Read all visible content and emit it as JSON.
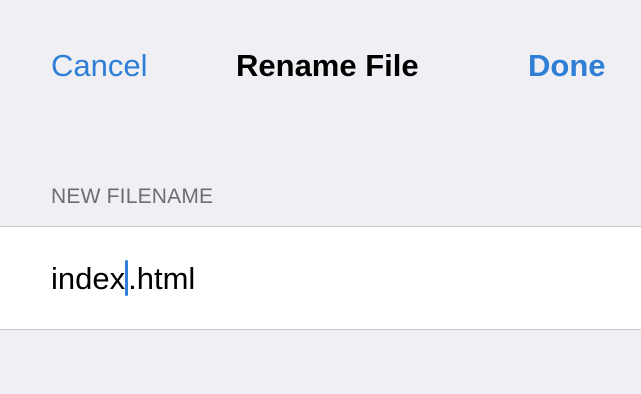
{
  "nav": {
    "cancel_label": "Cancel",
    "title": "Rename File",
    "done_label": "Done"
  },
  "form": {
    "section_header": "NEW FILENAME",
    "filename_before_cursor": "index",
    "filename_after_cursor": ".html"
  },
  "colors": {
    "accent": "#2f7fd6",
    "background": "#efeff4",
    "cell_background": "#ffffff",
    "secondary_text": "#6d6d72"
  }
}
